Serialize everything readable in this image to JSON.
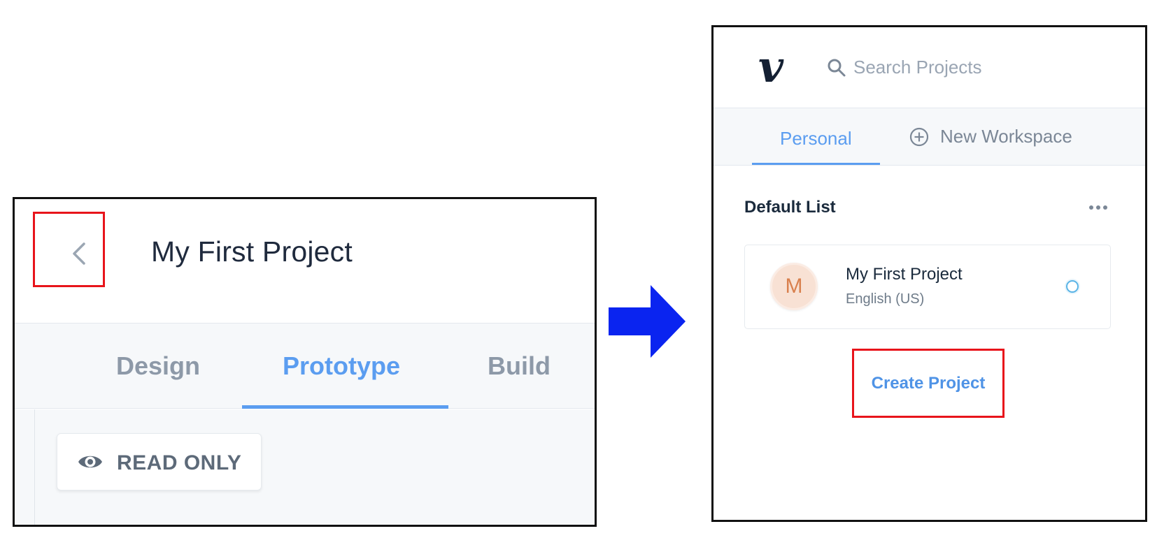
{
  "left_panel": {
    "title": "My First Project",
    "tabs": [
      {
        "label": "Design"
      },
      {
        "label": "Prototype"
      },
      {
        "label": "Build"
      }
    ],
    "active_tab": "Prototype",
    "badge": {
      "label": "READ ONLY",
      "icon": "eye-icon"
    },
    "back_icon": "chevron-left-icon"
  },
  "right_panel": {
    "logo": "v",
    "search": {
      "placeholder": "Search Projects",
      "value": "",
      "icon": "search-icon"
    },
    "tabs": {
      "personal": "Personal",
      "new_workspace": "New Workspace"
    },
    "list": {
      "title": "Default List",
      "projects": [
        {
          "initial": "M",
          "name": "My First Project",
          "language": "English (US)"
        }
      ]
    },
    "create_label": "Create Project"
  },
  "colors": {
    "accent": "#5b9df0",
    "highlight_box": "#e8141b",
    "arrow": "#0a24f0"
  }
}
